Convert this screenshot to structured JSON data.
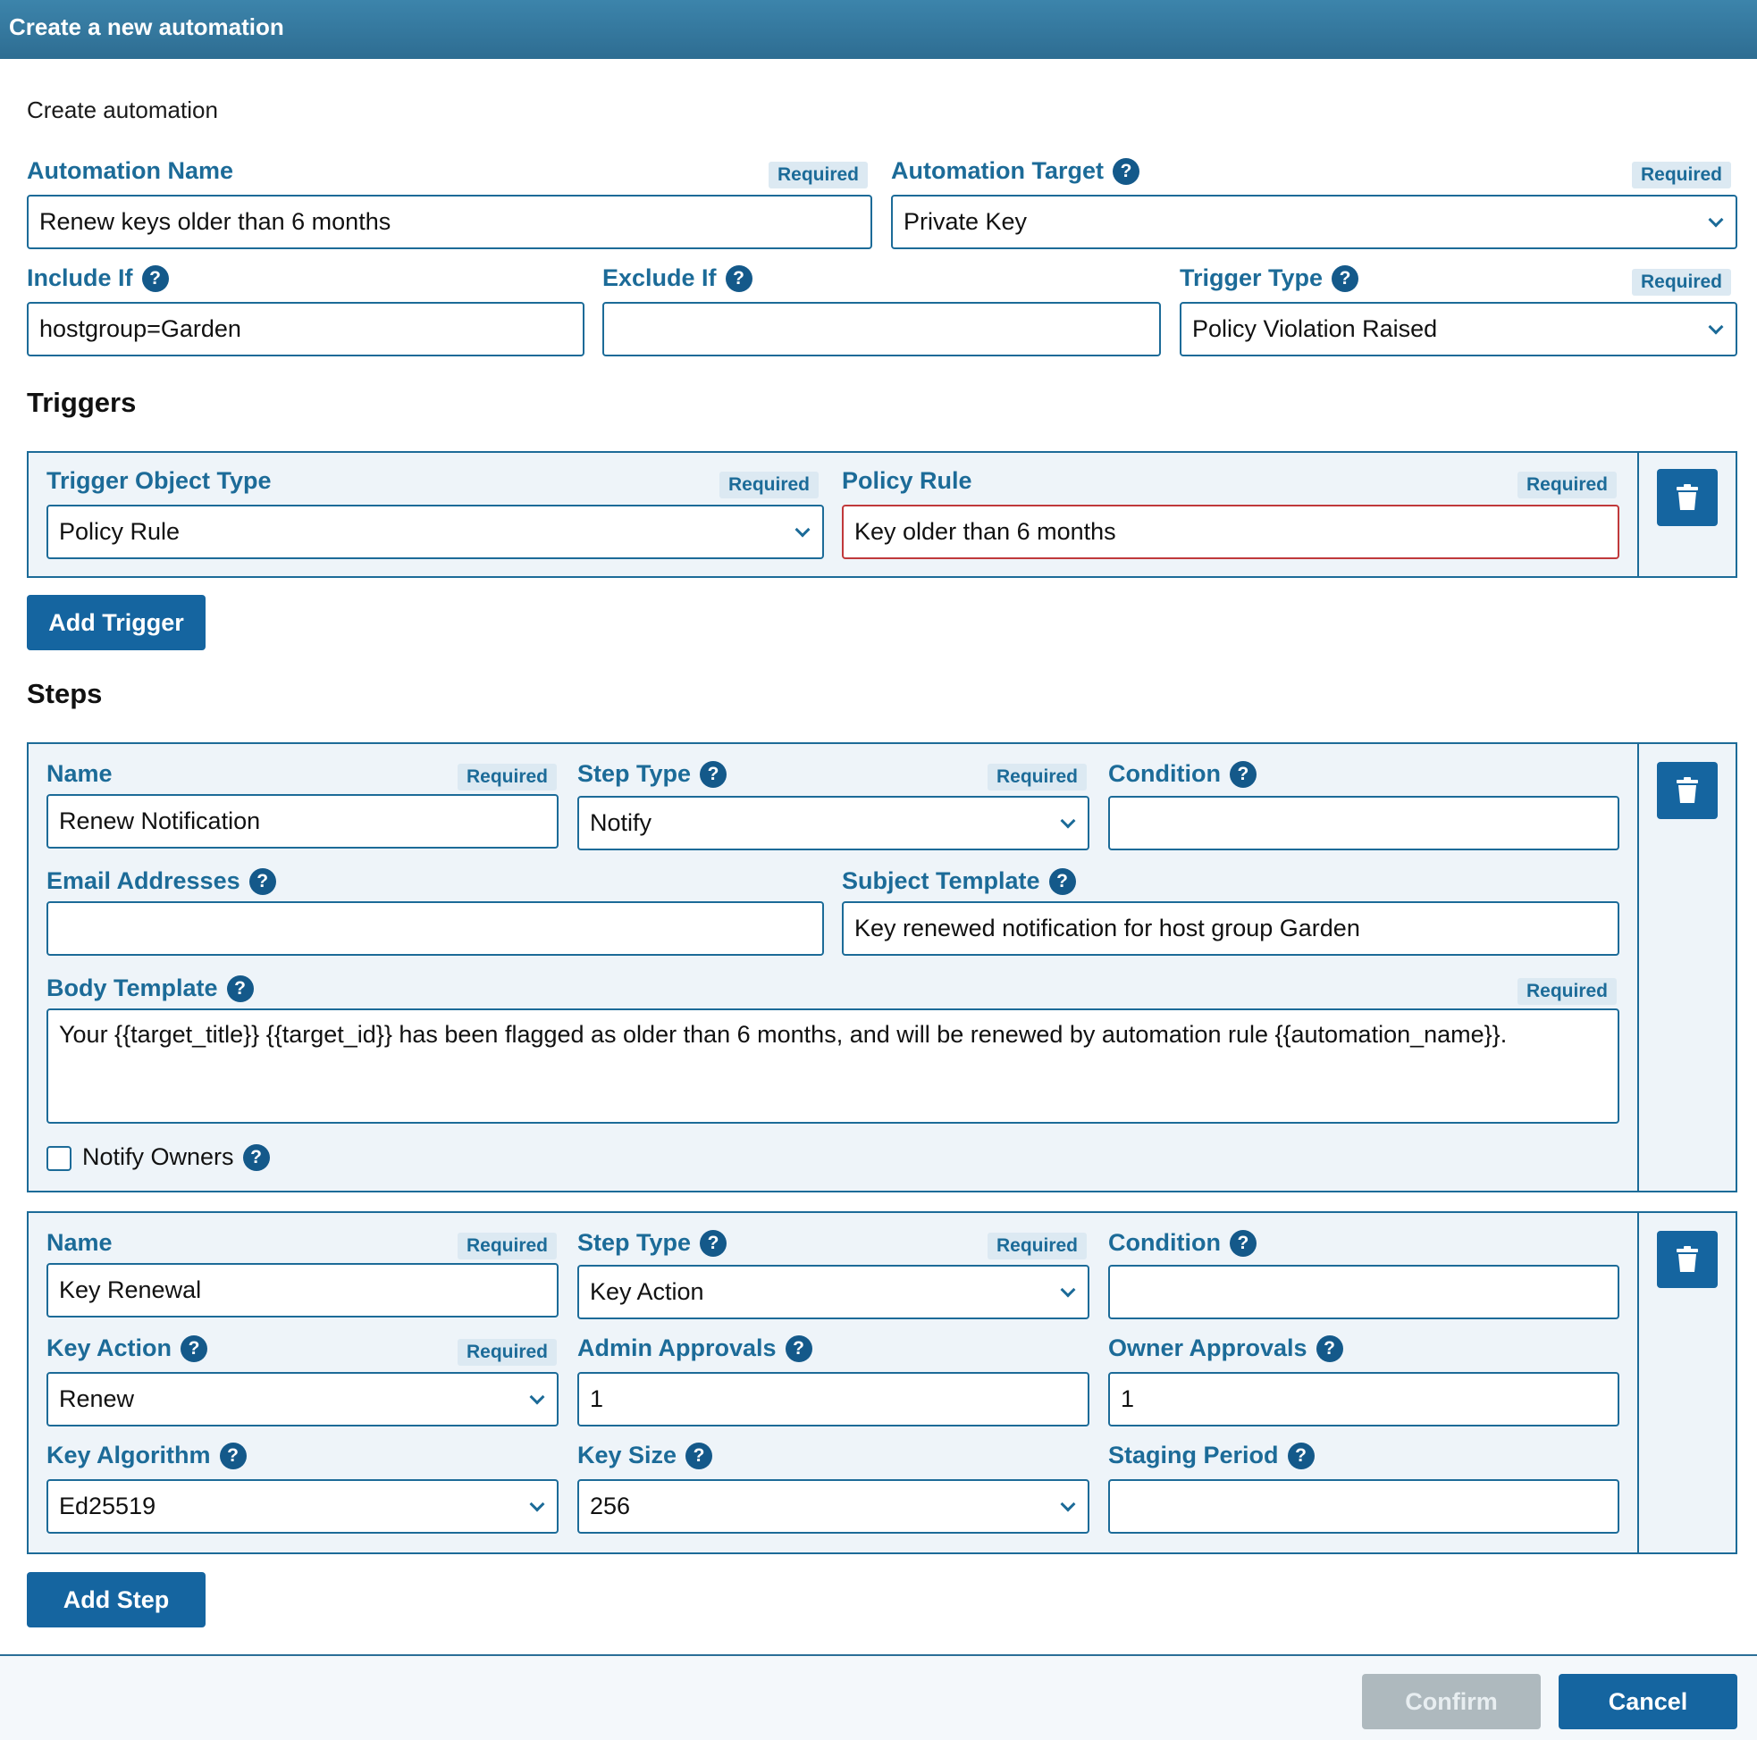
{
  "window": {
    "title": "Create a new automation"
  },
  "page": {
    "subtitle": "Create automation"
  },
  "required_label": "Required",
  "help_glyph": "?",
  "form": {
    "automation_name": {
      "label": "Automation Name",
      "value": "Renew keys older than 6 months"
    },
    "automation_target": {
      "label": "Automation Target",
      "value": "Private Key"
    },
    "include_if": {
      "label": "Include If",
      "value": "hostgroup=Garden"
    },
    "exclude_if": {
      "label": "Exclude If",
      "value": ""
    },
    "trigger_type": {
      "label": "Trigger Type",
      "value": "Policy Violation Raised"
    }
  },
  "triggers": {
    "heading": "Triggers",
    "trigger_object_type": {
      "label": "Trigger Object Type",
      "value": "Policy Rule"
    },
    "policy_rule": {
      "label": "Policy Rule",
      "value": "Key older than 6 months"
    },
    "add_button": "Add Trigger"
  },
  "steps": {
    "heading": "Steps",
    "step1": {
      "name": {
        "label": "Name",
        "value": "Renew Notification"
      },
      "step_type": {
        "label": "Step Type",
        "value": "Notify"
      },
      "condition": {
        "label": "Condition",
        "value": ""
      },
      "email_addresses": {
        "label": "Email Addresses",
        "value": ""
      },
      "subject_template": {
        "label": "Subject Template",
        "value": "Key renewed notification for host group Garden"
      },
      "body_template": {
        "label": "Body Template",
        "value": "Your {{target_title}} {{target_id}} has been flagged as older than 6 months, and will be renewed by automation rule {{automation_name}}."
      },
      "notify_owners": {
        "label": "Notify Owners",
        "checked": false
      }
    },
    "step2": {
      "name": {
        "label": "Name",
        "value": "Key Renewal"
      },
      "step_type": {
        "label": "Step Type",
        "value": "Key Action"
      },
      "condition": {
        "label": "Condition",
        "value": ""
      },
      "key_action": {
        "label": "Key Action",
        "value": "Renew"
      },
      "admin_approvals": {
        "label": "Admin Approvals",
        "value": "1"
      },
      "owner_approvals": {
        "label": "Owner Approvals",
        "value": "1"
      },
      "key_algorithm": {
        "label": "Key Algorithm",
        "value": "Ed25519"
      },
      "key_size": {
        "label": "Key Size",
        "value": "256"
      },
      "staging_period": {
        "label": "Staging Period",
        "value": ""
      }
    },
    "add_button": "Add Step"
  },
  "footer": {
    "confirm": "Confirm",
    "cancel": "Cancel"
  },
  "colors": {
    "accent": "#1c6b98",
    "button": "#1565a0",
    "error": "#c0393b",
    "panel": "#eef4f9"
  }
}
